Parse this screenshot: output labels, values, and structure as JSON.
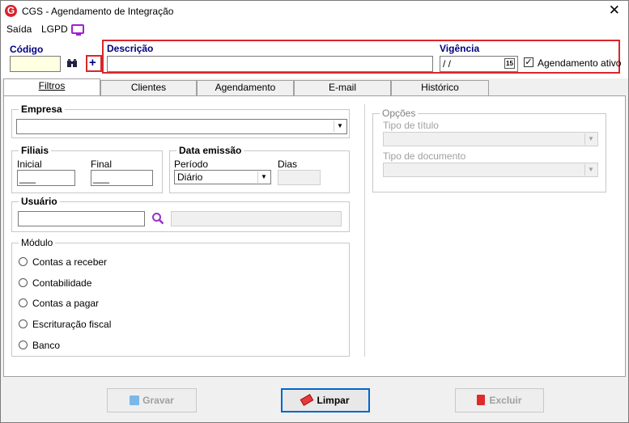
{
  "window": {
    "title": "CGS - Agendamento de Integração",
    "logo_letter": "G",
    "close_glyph": "✕"
  },
  "menu": {
    "items": [
      "Saída",
      "LGPD"
    ]
  },
  "header": {
    "codigo_label": "Código",
    "codigo_value": "",
    "descricao_label": "Descrição",
    "descricao_value": "",
    "vigencia_label": "Vigência",
    "vigencia_value": " / /",
    "calendar_glyph": "15",
    "agendamento_ativo_label": "Agendamento ativo",
    "agendamento_ativo_checked": true,
    "accent_red": "#d9262c"
  },
  "tabs": [
    "Filtros",
    "Clientes",
    "Agendamento",
    "E-mail",
    "Histórico"
  ],
  "selected_tab": "Filtros",
  "filtros": {
    "empresa_label": "Empresa",
    "empresa_value": "",
    "filiais_label": "Filiais",
    "inicial_label": "Inicial",
    "inicial_value": "___",
    "final_label": "Final",
    "final_value": "___",
    "data_emissao_label": "Data emissão",
    "periodo_label": "Período",
    "periodo_value": "Diário",
    "dias_label": "Dias",
    "dias_value": "",
    "usuario_label": "Usuário",
    "usuario_value": "",
    "modulo_label": "Módulo",
    "modulos": [
      "Contas a receber",
      "Contabilidade",
      "Contas a pagar",
      "Escrituração fiscal",
      "Banco"
    ],
    "opcoes_label": "Opções",
    "tipo_titulo_label": "Tipo de título",
    "tipo_documento_label": "Tipo de documento"
  },
  "buttons": {
    "gravar": "Gravar",
    "limpar": "Limpar",
    "excluir": "Excluir"
  }
}
